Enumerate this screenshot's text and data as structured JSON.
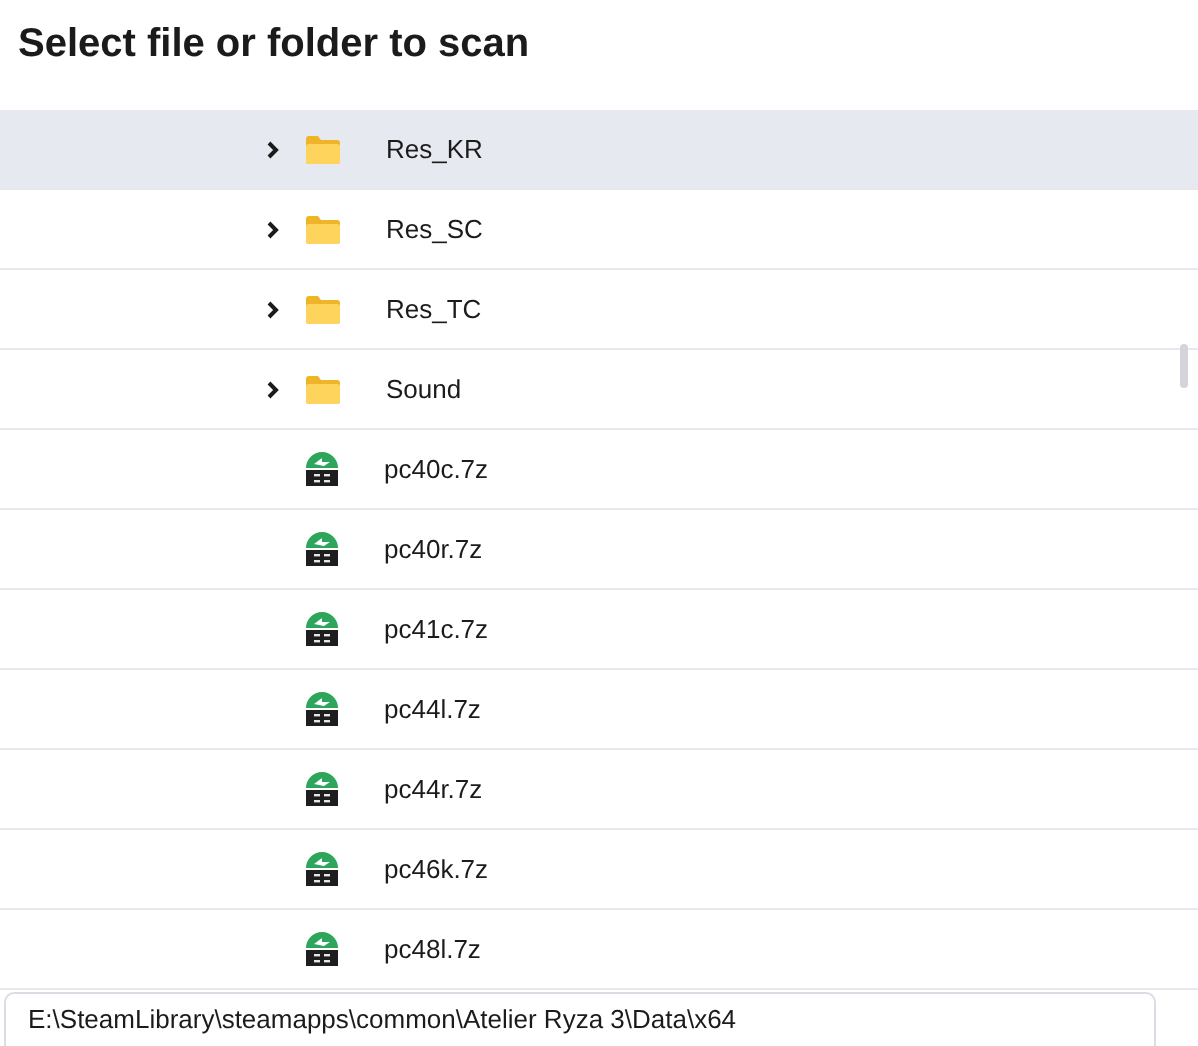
{
  "title": "Select file or folder to scan",
  "items": [
    {
      "kind": "folder",
      "name": "Res_KR",
      "selected": true
    },
    {
      "kind": "folder",
      "name": "Res_SC",
      "selected": false
    },
    {
      "kind": "folder",
      "name": "Res_TC",
      "selected": false
    },
    {
      "kind": "folder",
      "name": "Sound",
      "selected": false
    },
    {
      "kind": "archive",
      "name": "pc40c.7z",
      "selected": false
    },
    {
      "kind": "archive",
      "name": "pc40r.7z",
      "selected": false
    },
    {
      "kind": "archive",
      "name": "pc41c.7z",
      "selected": false
    },
    {
      "kind": "archive",
      "name": "pc44l.7z",
      "selected": false
    },
    {
      "kind": "archive",
      "name": "pc44r.7z",
      "selected": false
    },
    {
      "kind": "archive",
      "name": "pc46k.7z",
      "selected": false
    },
    {
      "kind": "archive",
      "name": "pc48l.7z",
      "selected": false
    }
  ],
  "path_field": {
    "value": "E:\\SteamLibrary\\steamapps\\common\\Atelier Ryza 3\\Data\\x64"
  }
}
